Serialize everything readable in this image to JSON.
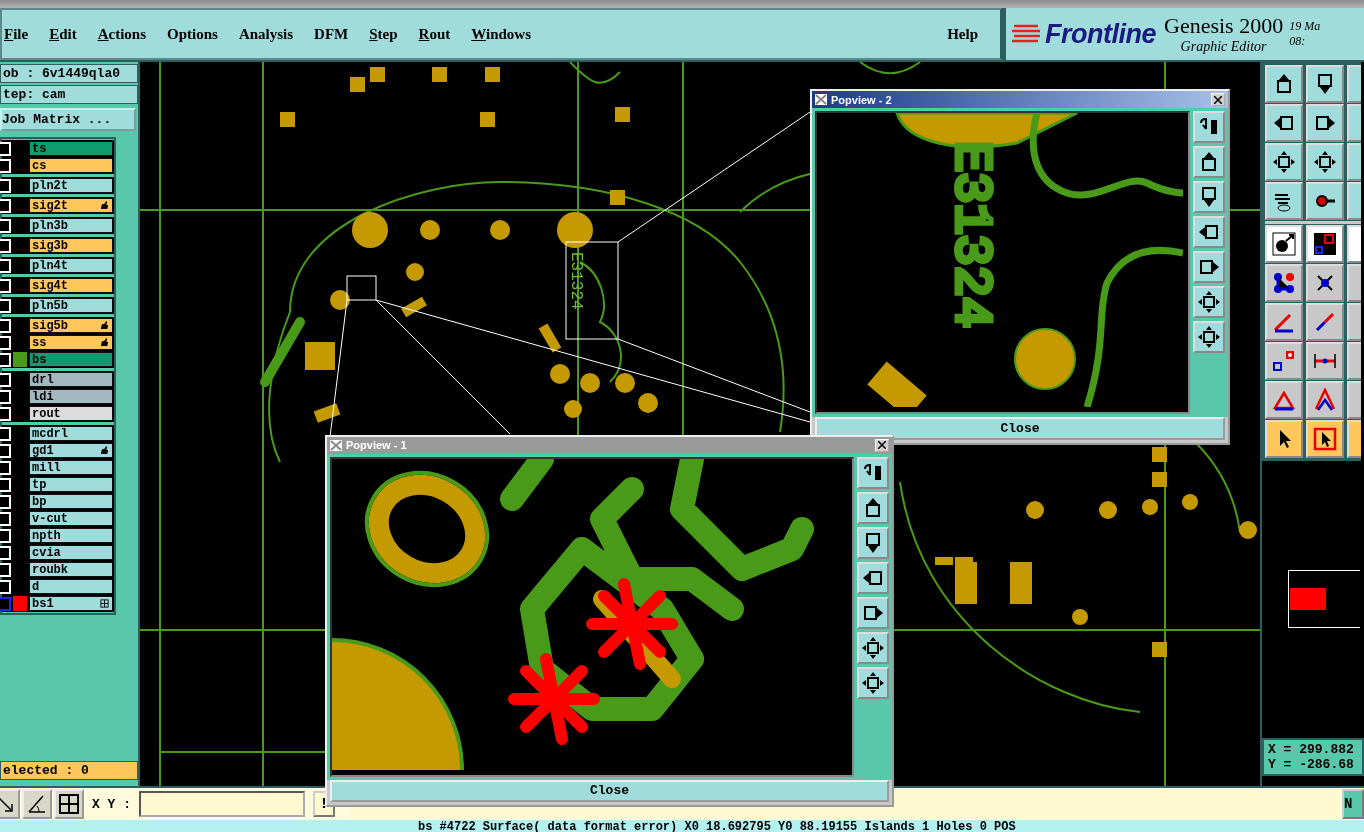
{
  "menu_bar": {
    "items": [
      {
        "label": "File",
        "underline_first": true
      },
      {
        "label": "Edit",
        "underline_first": true
      },
      {
        "label": "Actions",
        "underline_first": true
      },
      {
        "label": "Options",
        "underline_first": false
      },
      {
        "label": "Analysis",
        "underline_first": false
      },
      {
        "label": "DFM",
        "underline_first": false
      },
      {
        "label": "Step",
        "underline_first": true
      },
      {
        "label": "Rout",
        "underline_first": true
      },
      {
        "label": "Windows",
        "underline_first": true
      }
    ],
    "help": "Help"
  },
  "brand": {
    "logo": "Frontline",
    "product": "Genesis 2000",
    "subtitle": "Graphic Editor",
    "date": "19 Ma",
    "time": "08:"
  },
  "job_panel": {
    "job": "ob : 6v1449qla0",
    "step": "tep: cam",
    "matrix_button": "Job Matrix ..."
  },
  "layer_groups": [
    {
      "layers": [
        {
          "name": "ts",
          "color": "#0e9b6e",
          "checked": false,
          "focused": false
        },
        {
          "name": "cs",
          "color": "#ffc65c",
          "checked": false,
          "focused": false
        }
      ]
    },
    {
      "layers": [
        {
          "name": "pln2t",
          "color": "#a0dcdc",
          "checked": false,
          "focused": false
        }
      ]
    },
    {
      "layers": [
        {
          "name": "sig2t",
          "color": "#ffc65c",
          "checked": false,
          "focused": false,
          "mark_icon": {
            "kind": "hand"
          }
        }
      ]
    },
    {
      "layers": [
        {
          "name": "pln3b",
          "color": "#a0dcdc",
          "checked": false,
          "focused": false
        }
      ]
    },
    {
      "layers": [
        {
          "name": "sig3b",
          "color": "#ffc65c",
          "checked": false,
          "focused": false
        }
      ]
    },
    {
      "layers": [
        {
          "name": "pln4t",
          "color": "#a0dcdc",
          "checked": false,
          "focused": false
        }
      ]
    },
    {
      "layers": [
        {
          "name": "sig4t",
          "color": "#ffc65c",
          "checked": false,
          "focused": false
        }
      ]
    },
    {
      "layers": [
        {
          "name": "pln5b",
          "color": "#a0dcdc",
          "checked": false,
          "focused": false
        }
      ]
    },
    {
      "layers": [
        {
          "name": "sig5b",
          "color": "#ffc65c",
          "checked": false,
          "focused": false,
          "mark_icon": {
            "kind": "hand"
          }
        },
        {
          "name": "ss",
          "color": "#ffc65c",
          "checked": false,
          "focused": false,
          "mark_icon": {
            "kind": "hand"
          }
        },
        {
          "name": "bs",
          "color": "#0e9b6e",
          "checked": false,
          "focused": false,
          "swatch": {
            "color": "#4a9a1a"
          }
        }
      ]
    },
    {
      "layers": [
        {
          "name": "drl",
          "color": "#a4b8c0",
          "checked": false,
          "focused": false
        },
        {
          "name": "ldi",
          "color": "#a4b8c0",
          "checked": false,
          "focused": false
        },
        {
          "name": "rout",
          "color": "#dcdcdc",
          "checked": false,
          "focused": false
        }
      ]
    },
    {
      "layers": [
        {
          "name": "mcdrl",
          "color": "#a0dcdc",
          "checked": false,
          "focused": false
        },
        {
          "name": "gd1",
          "color": "#a0dcdc",
          "checked": false,
          "focused": false,
          "mark_icon": {
            "kind": "hand"
          }
        },
        {
          "name": "mill",
          "color": "#a0dcdc",
          "checked": false,
          "focused": false
        },
        {
          "name": "tp",
          "color": "#a0dcdc",
          "checked": false,
          "focused": false
        },
        {
          "name": "bp",
          "color": "#a0dcdc",
          "checked": false,
          "focused": false
        },
        {
          "name": "v-cut",
          "color": "#a0dcdc",
          "checked": false,
          "focused": false
        },
        {
          "name": "npth",
          "color": "#a0dcdc",
          "checked": false,
          "focused": false
        },
        {
          "name": "cvia",
          "color": "#a0dcdc",
          "checked": false,
          "focused": false
        },
        {
          "name": "roubk",
          "color": "#a0dcdc",
          "checked": false,
          "focused": false
        },
        {
          "name": "d",
          "color": "#a0dcdc",
          "checked": false,
          "focused": false
        },
        {
          "name": "bs1",
          "color": "#a0dcdc",
          "checked": false,
          "focused": true,
          "swatch": {
            "color": "#ff0000"
          },
          "mark_icon": {
            "kind": "grid"
          }
        }
      ]
    }
  ],
  "selected_count": "elected : 0",
  "board": {
    "silk_text": "E31324"
  },
  "popviews": [
    {
      "title": "Popview - 2",
      "active": true,
      "close": "Close",
      "silk_text": "E31324"
    },
    {
      "title": "Popview - 1",
      "active": false,
      "close": "Close"
    }
  ],
  "coordinates": {
    "x": "X = 299.882",
    "y": "Y = -286.68"
  },
  "bottom_bar": {
    "xy_label": "X Y :",
    "exclaim": "!",
    "right_button": "N"
  },
  "status_bar": "bs #4722 Surface( data format error) X0 18.692795 Y0 88.19155 Islands 1 Holes 0 POS"
}
